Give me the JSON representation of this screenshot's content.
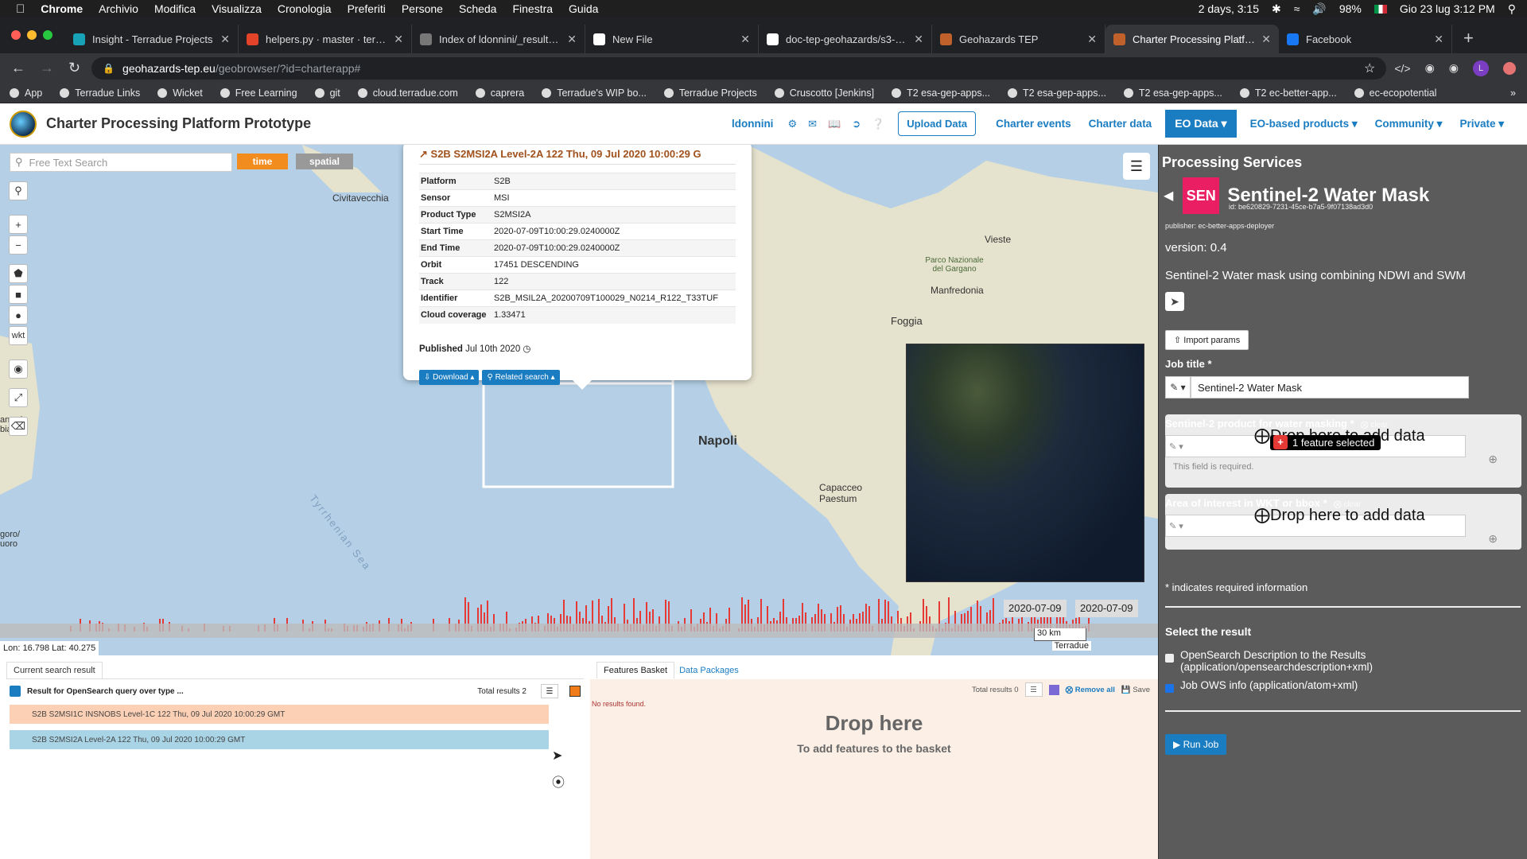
{
  "macbar": {
    "menus": [
      "Chrome",
      "Archivio",
      "Modifica",
      "Visualizza",
      "Cronologia",
      "Preferiti",
      "Persone",
      "Scheda",
      "Finestra",
      "Guida"
    ],
    "battery_timer": "2 days, 3:15",
    "battery": "98%",
    "datetime": "Gio 23 lug  3:12 PM"
  },
  "tabs": [
    {
      "title": "Insight - Terradue Projects",
      "color": "#17a2b8"
    },
    {
      "title": "helpers.py · master · terrad",
      "color": "#e24329"
    },
    {
      "title": "Index of ldonnini/_results/w",
      "color": "#777"
    },
    {
      "title": "New File",
      "color": "#fff"
    },
    {
      "title": "doc-tep-geohazards/s3-slst",
      "color": "#fff"
    },
    {
      "title": "Geohazards TEP",
      "color": "#c0612b"
    },
    {
      "title": "Charter Processing Platform",
      "color": "#c0612b",
      "active": true
    },
    {
      "title": "Facebook",
      "color": "#1877f2"
    }
  ],
  "url": {
    "host": "geohazards-tep.eu",
    "path": "/geobrowser/?id=charterapp#"
  },
  "bookmarks": [
    "App",
    "Terradue Links",
    "Wicket",
    "Free Learning",
    "git",
    "cloud.terradue.com",
    "caprera",
    "Terradue's WIP bo...",
    "Terradue Projects",
    "Cruscotto [Jenkins]",
    "T2 esa-gep-apps...",
    "T2 esa-gep-apps...",
    "T2 esa-gep-apps...",
    "T2 ec-better-app...",
    "ec-ecopotential"
  ],
  "header": {
    "title": "Charter Processing Platform Prototype",
    "user": "ldonnini",
    "upload": "Upload Data",
    "nav": [
      "Charter events",
      "Charter data",
      "EO Data",
      "EO-based products",
      "Community",
      "Private"
    ]
  },
  "map": {
    "search_placeholder": "Free Text Search",
    "time": "time",
    "spatial": "spatial",
    "wkt": "wkt",
    "places": [
      "Civitavecchia",
      "Vieste",
      "Parco Nazionale del Gargano",
      "Manfredonia",
      "Foggia",
      "Napoli",
      "Capacceo Paestum",
      "Tyrrhenian Sea",
      "anoa/ bia",
      "goro/ uoro"
    ],
    "coords": "Lon: 16.798 Lat: 40.275",
    "scale": "30 km",
    "attribution": "Terradue",
    "dates": [
      "2020-07-09",
      "2020-07-09"
    ]
  },
  "popup": {
    "title": "S2B S2MSI2A Level-2A 122 Thu, 09 Jul 2020 10:00:29 G",
    "rows": [
      {
        "k": "Platform",
        "v": "S2B"
      },
      {
        "k": "Sensor",
        "v": "MSI"
      },
      {
        "k": "Product Type",
        "v": "S2MSI2A"
      },
      {
        "k": "Start Time",
        "v": "2020-07-09T10:00:29.0240000Z"
      },
      {
        "k": "End Time",
        "v": "2020-07-09T10:00:29.0240000Z"
      },
      {
        "k": "Orbit",
        "v": "17451 DESCENDING"
      },
      {
        "k": "Track",
        "v": "122"
      },
      {
        "k": "Identifier",
        "v": "S2B_MSIL2A_20200709T100029_N0214_R122_T33TUF"
      },
      {
        "k": "Cloud coverage",
        "v": "1.33471"
      }
    ],
    "published_label": "Published",
    "published": "Jul 10th 2020",
    "download": "Download",
    "related": "Related search"
  },
  "panel": {
    "heading": "Processing Services",
    "logo": "SEN",
    "title": "Sentinel-2 Water Mask",
    "id": "id: be620829-7231-45ce-b7a5-9f07138ad3d0",
    "publisher": "publisher: ec-better-apps-deployer",
    "version": "version: 0.4",
    "description": "Sentinel-2 Water mask using combining NDWI and SWM",
    "import": "Import params",
    "job_title_label": "Job title *",
    "job_title": "Sentinel-2 Water Mask",
    "field1_label": "Sentinel-2 product for water masking *",
    "field2_label": "Area of interest in WKT or bbox *",
    "clear": "clear",
    "drop": "Drop here to add data",
    "required": "This field is required.",
    "tooltip": "1 feature selected",
    "note": "* indicates required information",
    "select": "Select the result",
    "opt1": "OpenSearch Description to the Results (application/opensearchdescription+xml)",
    "opt2": "Job OWS info (application/atom+xml)",
    "run": "Run Job"
  },
  "results": {
    "tab": "Current search result",
    "query": "Result for OpenSearch query over type ...",
    "total": "Total results  2",
    "rows": [
      {
        "text": "S2B S2MSI1C INSNOBS Level-1C 122 Thu, 09 Jul 2020 10:00:29 GMT",
        "color": "#fbd0b5"
      },
      {
        "text": "S2B S2MSI2A Level-2A 122 Thu, 09 Jul 2020 10:00:29 GMT",
        "color": "#a9d4e6"
      }
    ]
  },
  "basket": {
    "tab1": "Features Basket",
    "tab2": "Data Packages",
    "total": "Total results  0",
    "remove": "Remove all",
    "save": "Save",
    "none": "No results found.",
    "drop": "Drop here",
    "sub": "To add features to the basket"
  }
}
